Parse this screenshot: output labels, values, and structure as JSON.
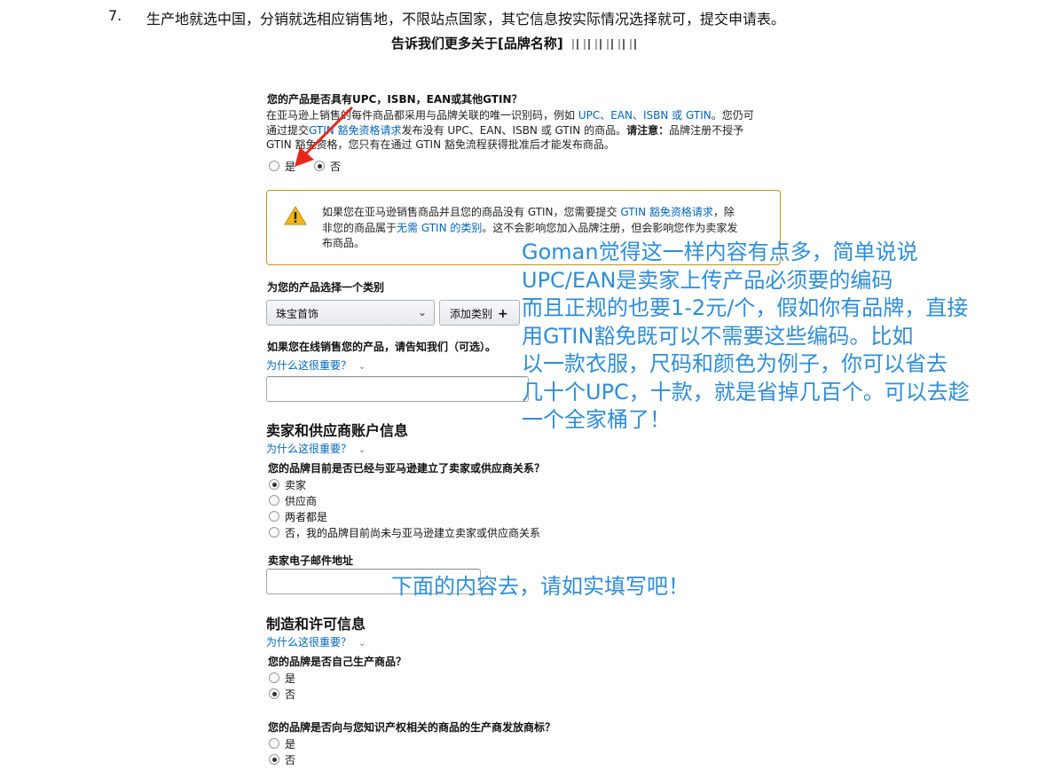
{
  "step": {
    "number": "7.",
    "text": "生产地就选中国，分销就选相应销售地，不限站点国家，其它信息按实际情况选择就可，提交申请表。"
  },
  "page_title": "告诉我们更多关于[品牌名称]",
  "gtin_question": {
    "label": "您的产品是否具有UPC，ISBN，EAN或其他GTIN？",
    "line1_a": "在亚马逊上销售的每件商品都采用与品牌关联的唯一识别码，例如 ",
    "line1_link": "UPC、EAN、ISBN 或 GTIN",
    "line1_b": "。您仍可",
    "line2_a": "通过提交",
    "line2_link": "GTIN 豁免资格请求",
    "line2_b": "发布没有 UPC、EAN、ISBN 或 GTIN 的商品。",
    "line2_bold": "请注意：",
    "line2_c": "品牌注册不授予",
    "line3": "GTIN 豁免资格，您只有在通过 GTIN 豁免流程获得批准后才能发布商品。",
    "options": [
      {
        "label": "是",
        "checked": false
      },
      {
        "label": "否",
        "checked": true
      }
    ]
  },
  "alert": {
    "icon": "warning-icon",
    "line1_a": "如果您在亚马逊销售商品并且您的商品没有 GTIN，您需要提交 ",
    "line1_link": "GTIN 豁免资格请求",
    "line1_b": "，除",
    "line2_a": "非您的商品属于",
    "line2_link": "无需 GTIN 的类别",
    "line2_b": "。这不会影响您加入品牌注册，但会影响您作为卖家发",
    "line3": "布商品。"
  },
  "category": {
    "label": "为您的产品选择一个类别",
    "selected": "珠宝首饰",
    "add_button": "添加类别"
  },
  "online": {
    "label": "如果您在线销售您的产品，请告知我们（可选）。",
    "why": "为什么这很重要？",
    "url_value": ""
  },
  "seller_section": {
    "title": "卖家和供应商账户信息",
    "why": "为什么这很重要？",
    "question": "您的品牌目前是否已经与亚马逊建立了卖家或供应商关系？",
    "options": [
      {
        "label": "卖家",
        "checked": true
      },
      {
        "label": "供应商",
        "checked": false
      },
      {
        "label": "两者都是",
        "checked": false
      },
      {
        "label": "否，我的品牌目前尚未与亚马逊建立卖家或供应商关系",
        "checked": false
      }
    ],
    "email_label": "卖家电子邮件地址",
    "email_value": ""
  },
  "manufacturing_section": {
    "title": "制造和许可信息",
    "why": "为什么这很重要？",
    "q1": "您的品牌是否自己生产商品？",
    "q1_options": [
      {
        "label": "是",
        "checked": false
      },
      {
        "label": "否",
        "checked": true
      }
    ],
    "q2": "您的品牌是否向与您知识产权相关的商品的生产商发放商标？",
    "q2_options": [
      {
        "label": "是",
        "checked": false
      },
      {
        "label": "否",
        "checked": true
      }
    ]
  },
  "annotation": {
    "lines": [
      "Goman觉得这一样内容有点多，简单说说",
      "UPC/EAN是卖家上传产品必须要的编码",
      "而且正规的也要1-2元/个，假如你有品牌，直接",
      "用GTIN豁免既可以不需要这些编码。比如",
      "以一款衣服，尺码和颜色为例子，你可以省去",
      "几十个UPC，十款，就是省掉几百个。可以去趁",
      "一个全家桶了！"
    ],
    "second_note": "下面的内容去，请如实填写吧！",
    "arrow_color": "#e8271c",
    "note_color": "#2e8ddb"
  }
}
